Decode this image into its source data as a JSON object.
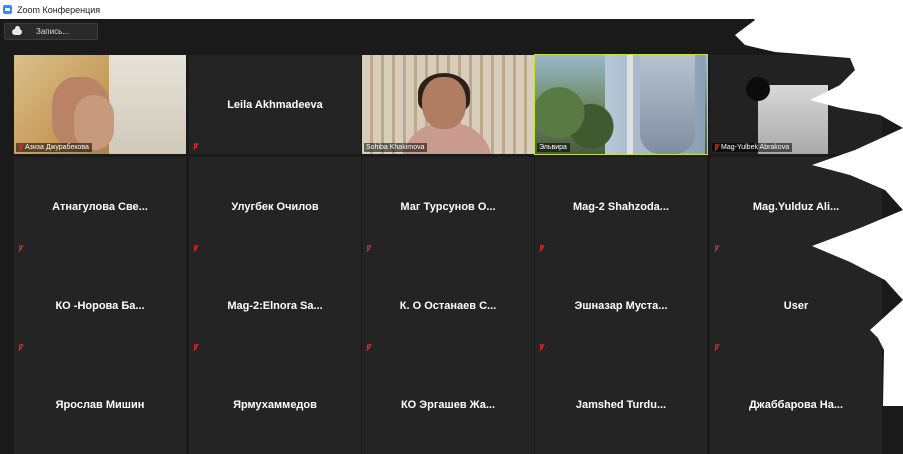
{
  "window": {
    "title": "Zoom Конференция"
  },
  "toolbar": {
    "record_label": "Запись..."
  },
  "tiles": [
    {
      "name": "Азиза Джурабекова",
      "video": true
    },
    {
      "name": "Leila Akhmadeeva",
      "video": false
    },
    {
      "name": "Sohiba Khakimova",
      "video": true
    },
    {
      "name": "Эльвира",
      "video": true,
      "active": true
    },
    {
      "name": "Mag-Yulbek Abrakova",
      "video": true
    },
    {
      "name": "Атнагулова Све...",
      "video": false
    },
    {
      "name": "Улугбек Очилов",
      "video": false
    },
    {
      "name": "Маг Турсунов О...",
      "video": false
    },
    {
      "name": "Mag-2 Shahzoda...",
      "video": false
    },
    {
      "name": "Mag.Yulduz Ali...",
      "video": false
    },
    {
      "name": "КО -Норова Ба...",
      "video": false
    },
    {
      "name": "Mag-2:Elnora Sa...",
      "video": false
    },
    {
      "name": "К. О Останаев С...",
      "video": false
    },
    {
      "name": "Эшназар Муста...",
      "video": false
    },
    {
      "name": "User",
      "video": false
    },
    {
      "name": "Ярослав Мишин",
      "video": false
    },
    {
      "name": "Ярмухаммедов",
      "video": false
    },
    {
      "name": "КО Эргашев Жа...",
      "video": false
    },
    {
      "name": "Jamshed Turdu...",
      "video": false
    },
    {
      "name": "Джаббарова На...",
      "video": false
    }
  ],
  "colors": {
    "active_speaker": "#c6e23a",
    "muted": "#e02828",
    "tile": "#242424",
    "background": "#1a1a1a"
  }
}
